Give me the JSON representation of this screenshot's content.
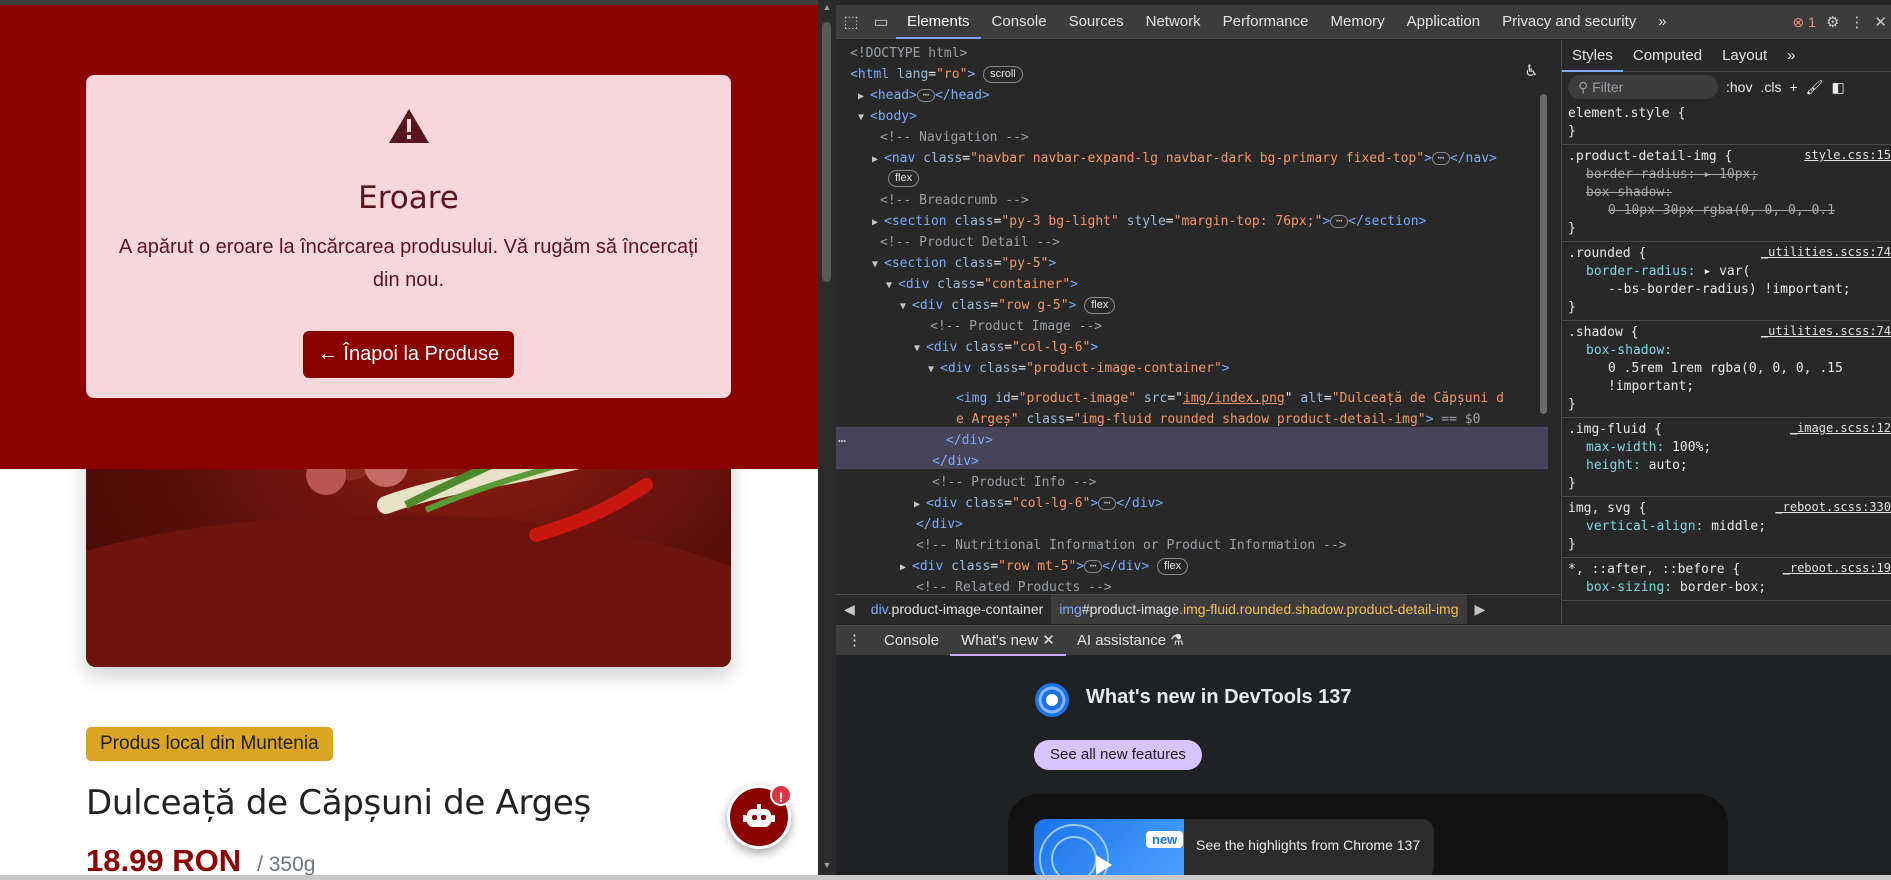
{
  "page": {
    "error": {
      "title": "Eroare",
      "message": "A apărut o eroare la încărcarea produsului. Vă rugăm să încercați din nou.",
      "back_button": "← Înapoi la Produse"
    },
    "product": {
      "badge": "Produs local din Muntenia",
      "title": "Dulceață de Căpșuni de Argeș",
      "price": "18.99 RON",
      "weight": "/ 350g"
    },
    "chat_badge": "!"
  },
  "devtools": {
    "tabs": [
      "Elements",
      "Console",
      "Sources",
      "Network",
      "Performance",
      "Memory",
      "Application",
      "Privacy and security"
    ],
    "more_tabs": "»",
    "error_count": "1",
    "dom": {
      "doctype": "<!DOCTYPE html>",
      "html_open": "<html",
      "html_lang_attr": "lang",
      "html_lang_val": "\"ro\"",
      "scroll_pill": "scroll",
      "head": "<head>",
      "head_close": "</head>",
      "body": "<body>",
      "c_nav": "<!-- Navigation -->",
      "nav_tag": "<nav",
      "nav_class": "\"navbar navbar-expand-lg navbar-dark bg-primary fixed-top\"",
      "nav_close": "</nav>",
      "flex_pill": "flex",
      "c_breadcrumb": "<!-- Breadcrumb -->",
      "section_tag": "<section",
      "section1_class": "\"py-3 bg-light\"",
      "section1_style": "\"margin-top: 76px;\"",
      "section_close": "</section>",
      "c_detail": "<!-- Product Detail -->",
      "section2_class": "\"py-5\"",
      "div_container": "\"container\"",
      "div_row": "\"row g-5\"",
      "c_image": "<!-- Product Image -->",
      "div_col": "\"col-lg-6\"",
      "div_img_container": "\"product-image-container\"",
      "img_id": "\"product-image\"",
      "img_src": "img/index.png",
      "img_alt1": "\"Dulceață de Căpșuni d",
      "img_alt2": "e Argeș\"",
      "img_class": "\"img-fluid rounded shadow product-detail-img\"",
      "img_eq": "== $0",
      "div_close": "</div>",
      "c_info": "<!-- Product Info -->",
      "c_nutri": "<!-- Nutritional Information or Product Information -->",
      "div_row_mt": "\"row mt-5\"",
      "c_related": "<!-- Related Products -->"
    },
    "breadcrumbs": [
      {
        "tag": "div",
        "rest": ".product-image-container"
      },
      {
        "tag": "img",
        "id": "#product-image",
        "cls": ".img-fluid.rounded.shadow.product-detail-img"
      }
    ],
    "styles_tabs": [
      "Styles",
      "Computed",
      "Layout"
    ],
    "filter_placeholder": "Filter",
    "hov": ":hov",
    "cls": ".cls",
    "rules": {
      "element_style": "element.style {",
      "r1_sel": ".product-detail-img {",
      "r1_src": "style.css:15",
      "r1_p1": "border-radius:",
      "r1_v1": "10px;",
      "r1_p2": "box-shadow:",
      "r1_v2": "0 10px 30px",
      "r1_v2b": "rgba(0, 0, 0, 0.1",
      "r2_sel": ".rounded {",
      "r2_src": "_utilities.scss:74",
      "r2_p1": "border-radius:",
      "r2_v1": "var(",
      "r2_v1b": "--bs-border-radius) !important;",
      "r3_sel": ".shadow {",
      "r3_src": "_utilities.scss:74",
      "r3_p1": "box-shadow:",
      "r3_v1": "0 .5rem 1rem",
      "r3_v1b": "rgba(0, 0, 0, .15",
      "r3_v1c": "!important;",
      "r4_sel": ".img-fluid {",
      "r4_src": "_image.scss:12",
      "r4_p1": "max-width:",
      "r4_v1": "100%;",
      "r4_p2": "height:",
      "r4_v2": "auto;",
      "r5_sel": "img, svg {",
      "r5_src": "_reboot.scss:330",
      "r5_p1": "vertical-align:",
      "r5_v1": "middle;",
      "r6_sel": "*, ::after, ::before {",
      "r6_src": "_reboot.scss:19",
      "r6_p1": "box-sizing:",
      "r6_v1": "border-box;",
      "close_brace": "}"
    },
    "drawer_tabs": [
      "Console",
      "What's new",
      "AI assistance"
    ],
    "whats_new": {
      "title": "What's new in DevTools 137",
      "button": "See all new features",
      "new_label": "new",
      "highlight": "See the highlights from Chrome 137"
    }
  },
  "colors": {
    "brand_red": "#8b0000",
    "error_bg": "#f8d7da",
    "badge_gold": "#daa520",
    "devtools_bg": "#282828",
    "accent_blue": "#7cacf8"
  }
}
